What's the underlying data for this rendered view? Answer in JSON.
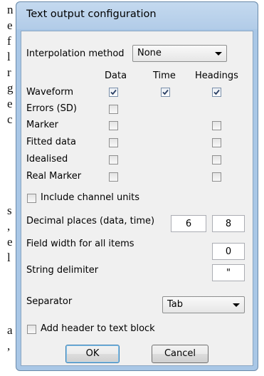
{
  "background_text": [
    "n",
    "e",
    "f",
    "l",
    "r",
    "g",
    "e",
    "c",
    "s",
    ",",
    "e",
    "l",
    "a",
    ","
  ],
  "dialog": {
    "title": "Text output configuration",
    "interpolation": {
      "label": "Interpolation method",
      "selected": "None"
    },
    "columns": {
      "data": "Data",
      "time": "Time",
      "headings": "Headings"
    },
    "rows": [
      {
        "label": "Waveform",
        "data": true,
        "time": true,
        "headings": true
      },
      {
        "label": "Errors (SD)",
        "data": false,
        "time": null,
        "headings": null
      },
      {
        "label": "Marker",
        "data": false,
        "time": null,
        "headings": false
      },
      {
        "label": "Fitted data",
        "data": false,
        "time": null,
        "headings": false
      },
      {
        "label": "Idealised",
        "data": false,
        "time": null,
        "headings": false
      },
      {
        "label": "Real Marker",
        "data": false,
        "time": null,
        "headings": false
      }
    ],
    "include_units": {
      "label": "Include channel units",
      "checked": false
    },
    "decimal_places": {
      "label": "Decimal places (data, time)",
      "data_value": "6",
      "time_value": "8"
    },
    "field_width": {
      "label": "Field width for all items",
      "value": "0"
    },
    "string_delimiter": {
      "label": "String delimiter",
      "value": "\""
    },
    "separator": {
      "label": "Separator",
      "selected": "Tab"
    },
    "add_header": {
      "label": "Add header to text block",
      "checked": false
    },
    "buttons": {
      "ok": "OK",
      "cancel": "Cancel"
    }
  }
}
